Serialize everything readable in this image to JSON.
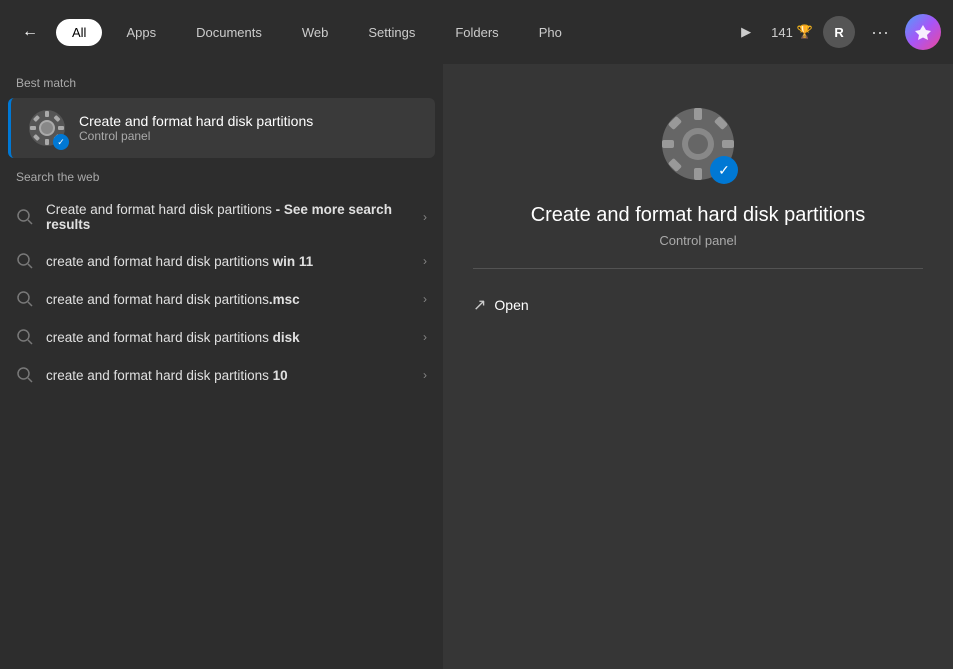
{
  "topbar": {
    "back_icon": "←",
    "filters": [
      {
        "id": "all",
        "label": "All",
        "active": true
      },
      {
        "id": "apps",
        "label": "Apps",
        "active": false
      },
      {
        "id": "documents",
        "label": "Documents",
        "active": false
      },
      {
        "id": "web",
        "label": "Web",
        "active": false
      },
      {
        "id": "settings",
        "label": "Settings",
        "active": false
      },
      {
        "id": "folders",
        "label": "Folders",
        "active": false
      },
      {
        "id": "photos",
        "label": "Pho",
        "active": false
      }
    ],
    "play_icon": "▶",
    "score": "141",
    "score_icon": "🏆",
    "avatar_label": "R",
    "more_icon": "···"
  },
  "left_panel": {
    "best_match_label": "Best match",
    "best_match": {
      "title": "Create and format hard disk partitions",
      "subtitle": "Control panel"
    },
    "search_web_label": "Search the web",
    "web_results": [
      {
        "text_normal": "Create and format hard disk partitions",
        "text_bold": "",
        "suffix": " - See more search results",
        "full": "Create and format hard disk partitions - See more search results"
      },
      {
        "text_normal": "create and format hard disk partitions ",
        "text_bold": "win 11",
        "suffix": "",
        "full": "create and format hard disk partitions win 11"
      },
      {
        "text_normal": "create and format hard disk partitions",
        "text_bold": ".msc",
        "suffix": "",
        "full": "create and format hard disk partitions.msc"
      },
      {
        "text_normal": "create and format hard disk partitions ",
        "text_bold": "disk",
        "suffix": "",
        "full": "create and format hard disk partitions disk"
      },
      {
        "text_normal": "create and format hard disk partitions ",
        "text_bold": "10",
        "suffix": "",
        "full": "create and format hard disk partitions 10"
      }
    ]
  },
  "right_panel": {
    "title": "Create and format hard disk partitions",
    "subtitle": "Control panel",
    "open_label": "Open"
  }
}
